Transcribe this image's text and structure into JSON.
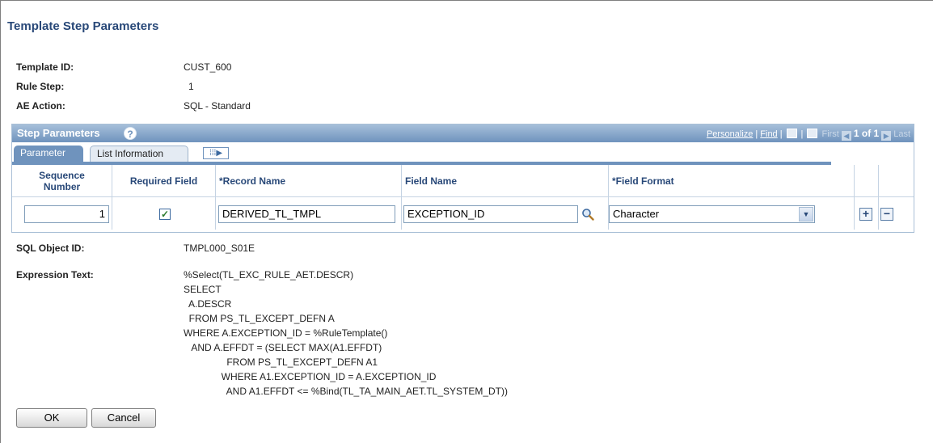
{
  "page": {
    "title": "Template Step Parameters"
  },
  "info": {
    "template_id_label": "Template ID:",
    "template_id_value": "CUST_600",
    "rule_step_label": "Rule Step:",
    "rule_step_value": "1",
    "ae_action_label": "AE Action:",
    "ae_action_value": "SQL - Standard"
  },
  "grid": {
    "title": "Step Parameters",
    "help": "?",
    "nav": {
      "personalize": "Personalize",
      "find": "Find",
      "first": "First",
      "count": "1 of 1",
      "last": "Last"
    },
    "tabs": {
      "parameter": "Parameter",
      "list_information": "List Information",
      "expand": "⁞⁞⁞▶"
    },
    "columns": {
      "sequence_number": "Sequence Number",
      "required_field": "Required Field",
      "record_name": "*Record Name",
      "field_name": "Field Name",
      "field_format": "*Field Format"
    },
    "row": {
      "sequence_number": "1",
      "required_checked": "✓",
      "record_name": "DERIVED_TL_TMPL",
      "field_name": "EXCEPTION_ID",
      "field_format": "Character"
    },
    "row_add": "+",
    "row_delete": "−"
  },
  "sql": {
    "object_id_label": "SQL Object ID:",
    "object_id_value": "TMPL000_S01E",
    "expression_label": "Expression Text:",
    "expression_lines": [
      "%Select(TL_EXC_RULE_AET.DESCR)",
      "SELECT",
      "  A.DESCR",
      "  FROM PS_TL_EXCEPT_DEFN A",
      "WHERE A.EXCEPTION_ID = %RuleTemplate()",
      "   AND A.EFFDT = (SELECT MAX(A1.EFFDT)",
      "                FROM PS_TL_EXCEPT_DEFN A1",
      "              WHERE A1.EXCEPTION_ID = A.EXCEPTION_ID",
      "                AND A1.EFFDT <= %Bind(TL_TA_MAIN_AET.TL_SYSTEM_DT))"
    ]
  },
  "buttons": {
    "ok": "OK",
    "cancel": "Cancel"
  }
}
